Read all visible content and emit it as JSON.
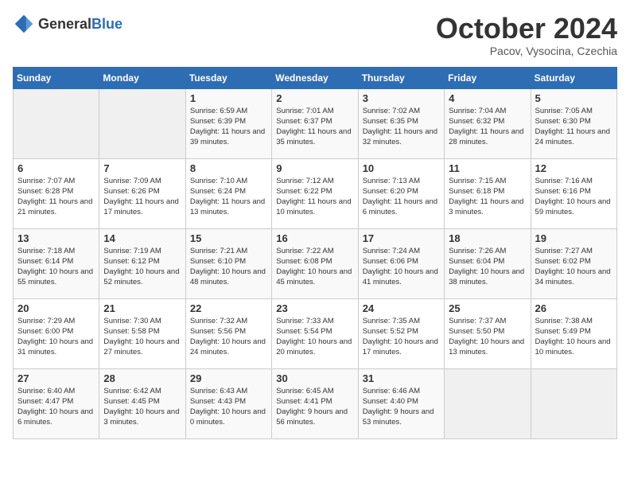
{
  "header": {
    "logo_general": "General",
    "logo_blue": "Blue",
    "title": "October 2024",
    "location": "Pacov, Vysocina, Czechia"
  },
  "weekdays": [
    "Sunday",
    "Monday",
    "Tuesday",
    "Wednesday",
    "Thursday",
    "Friday",
    "Saturday"
  ],
  "weeks": [
    [
      {
        "day": "",
        "info": ""
      },
      {
        "day": "",
        "info": ""
      },
      {
        "day": "1",
        "info": "Sunrise: 6:59 AM\nSunset: 6:39 PM\nDaylight: 11 hours and 39 minutes."
      },
      {
        "day": "2",
        "info": "Sunrise: 7:01 AM\nSunset: 6:37 PM\nDaylight: 11 hours and 35 minutes."
      },
      {
        "day": "3",
        "info": "Sunrise: 7:02 AM\nSunset: 6:35 PM\nDaylight: 11 hours and 32 minutes."
      },
      {
        "day": "4",
        "info": "Sunrise: 7:04 AM\nSunset: 6:32 PM\nDaylight: 11 hours and 28 minutes."
      },
      {
        "day": "5",
        "info": "Sunrise: 7:05 AM\nSunset: 6:30 PM\nDaylight: 11 hours and 24 minutes."
      }
    ],
    [
      {
        "day": "6",
        "info": "Sunrise: 7:07 AM\nSunset: 6:28 PM\nDaylight: 11 hours and 21 minutes."
      },
      {
        "day": "7",
        "info": "Sunrise: 7:09 AM\nSunset: 6:26 PM\nDaylight: 11 hours and 17 minutes."
      },
      {
        "day": "8",
        "info": "Sunrise: 7:10 AM\nSunset: 6:24 PM\nDaylight: 11 hours and 13 minutes."
      },
      {
        "day": "9",
        "info": "Sunrise: 7:12 AM\nSunset: 6:22 PM\nDaylight: 11 hours and 10 minutes."
      },
      {
        "day": "10",
        "info": "Sunrise: 7:13 AM\nSunset: 6:20 PM\nDaylight: 11 hours and 6 minutes."
      },
      {
        "day": "11",
        "info": "Sunrise: 7:15 AM\nSunset: 6:18 PM\nDaylight: 11 hours and 3 minutes."
      },
      {
        "day": "12",
        "info": "Sunrise: 7:16 AM\nSunset: 6:16 PM\nDaylight: 10 hours and 59 minutes."
      }
    ],
    [
      {
        "day": "13",
        "info": "Sunrise: 7:18 AM\nSunset: 6:14 PM\nDaylight: 10 hours and 55 minutes."
      },
      {
        "day": "14",
        "info": "Sunrise: 7:19 AM\nSunset: 6:12 PM\nDaylight: 10 hours and 52 minutes."
      },
      {
        "day": "15",
        "info": "Sunrise: 7:21 AM\nSunset: 6:10 PM\nDaylight: 10 hours and 48 minutes."
      },
      {
        "day": "16",
        "info": "Sunrise: 7:22 AM\nSunset: 6:08 PM\nDaylight: 10 hours and 45 minutes."
      },
      {
        "day": "17",
        "info": "Sunrise: 7:24 AM\nSunset: 6:06 PM\nDaylight: 10 hours and 41 minutes."
      },
      {
        "day": "18",
        "info": "Sunrise: 7:26 AM\nSunset: 6:04 PM\nDaylight: 10 hours and 38 minutes."
      },
      {
        "day": "19",
        "info": "Sunrise: 7:27 AM\nSunset: 6:02 PM\nDaylight: 10 hours and 34 minutes."
      }
    ],
    [
      {
        "day": "20",
        "info": "Sunrise: 7:29 AM\nSunset: 6:00 PM\nDaylight: 10 hours and 31 minutes."
      },
      {
        "day": "21",
        "info": "Sunrise: 7:30 AM\nSunset: 5:58 PM\nDaylight: 10 hours and 27 minutes."
      },
      {
        "day": "22",
        "info": "Sunrise: 7:32 AM\nSunset: 5:56 PM\nDaylight: 10 hours and 24 minutes."
      },
      {
        "day": "23",
        "info": "Sunrise: 7:33 AM\nSunset: 5:54 PM\nDaylight: 10 hours and 20 minutes."
      },
      {
        "day": "24",
        "info": "Sunrise: 7:35 AM\nSunset: 5:52 PM\nDaylight: 10 hours and 17 minutes."
      },
      {
        "day": "25",
        "info": "Sunrise: 7:37 AM\nSunset: 5:50 PM\nDaylight: 10 hours and 13 minutes."
      },
      {
        "day": "26",
        "info": "Sunrise: 7:38 AM\nSunset: 5:49 PM\nDaylight: 10 hours and 10 minutes."
      }
    ],
    [
      {
        "day": "27",
        "info": "Sunrise: 6:40 AM\nSunset: 4:47 PM\nDaylight: 10 hours and 6 minutes."
      },
      {
        "day": "28",
        "info": "Sunrise: 6:42 AM\nSunset: 4:45 PM\nDaylight: 10 hours and 3 minutes."
      },
      {
        "day": "29",
        "info": "Sunrise: 6:43 AM\nSunset: 4:43 PM\nDaylight: 10 hours and 0 minutes."
      },
      {
        "day": "30",
        "info": "Sunrise: 6:45 AM\nSunset: 4:41 PM\nDaylight: 9 hours and 56 minutes."
      },
      {
        "day": "31",
        "info": "Sunrise: 6:46 AM\nSunset: 4:40 PM\nDaylight: 9 hours and 53 minutes."
      },
      {
        "day": "",
        "info": ""
      },
      {
        "day": "",
        "info": ""
      }
    ]
  ]
}
